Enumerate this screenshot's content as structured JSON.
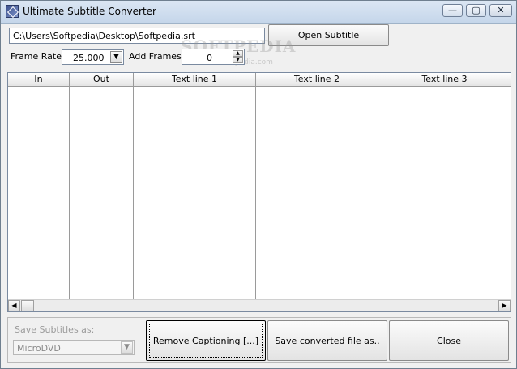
{
  "window": {
    "title": "Ultimate Subtitle Converter",
    "controls": {
      "minimize": "—",
      "maximize": "▢",
      "close": "✕"
    }
  },
  "top": {
    "path_value": "C:\\Users\\Softpedia\\Desktop\\Softpedia.srt",
    "open_button": "Open Subtitle",
    "frame_rate_label": "Frame Rate:",
    "frame_rate_value": "25.000",
    "add_frames_label": "Add Frames:",
    "add_frames_value": "0"
  },
  "watermark": {
    "text": "SOFTPEDIA",
    "url": "www.softpedia.com"
  },
  "grid": {
    "columns": [
      "In",
      "Out",
      "Text line 1",
      "Text line 2",
      "Text line 3"
    ]
  },
  "bottom": {
    "save_label": "Save Subtitles as:",
    "format_value": "MicroDVD",
    "remove_button": "Remove Captioning [...]",
    "save_button": "Save converted file as..",
    "close_button": "Close"
  },
  "icons": {
    "dropdown": "▼",
    "spin_up": "▲",
    "spin_down": "▼",
    "scroll_left": "◀",
    "scroll_right": "▶"
  }
}
